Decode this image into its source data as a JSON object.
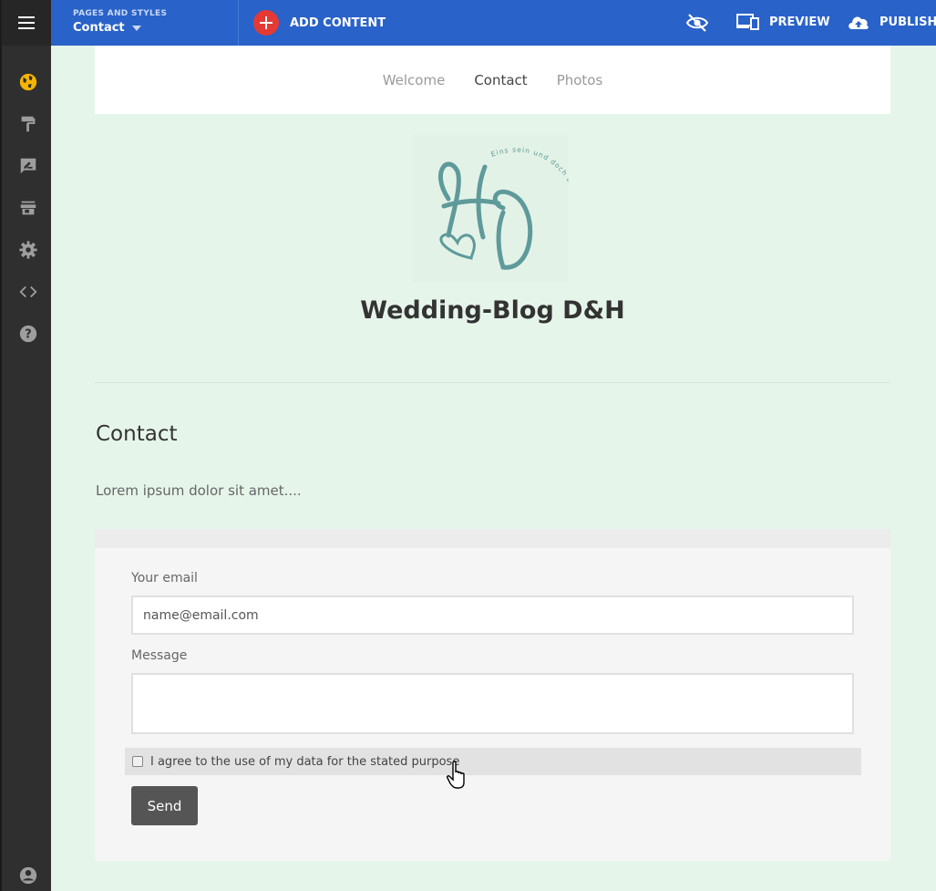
{
  "topbar": {
    "pages_caption": "PAGES AND STYLES",
    "current_page": "Contact",
    "add_content": "ADD CONTENT",
    "preview": "PREVIEW",
    "publish": "PUBLISH"
  },
  "sidebar": {
    "icons": [
      "menu-icon",
      "globe-icon",
      "paint-roller-icon",
      "edit-icon",
      "store-icon",
      "gear-icon",
      "code-icon",
      "help-icon",
      "account-icon"
    ]
  },
  "site_nav": {
    "items": [
      {
        "label": "Welcome",
        "active": false
      },
      {
        "label": "Contact",
        "active": true
      },
      {
        "label": "Photos",
        "active": false
      }
    ]
  },
  "site": {
    "title": "Wedding-Blog D&H",
    "logo_text": "Eins sein und doch zwei bleiben"
  },
  "page": {
    "heading": "Contact",
    "intro": "Lorem ipsum dolor sit amet...."
  },
  "form": {
    "email_label": "Your email",
    "email_placeholder": "name@email.com",
    "message_label": "Message",
    "consent_label": "I agree to the use of my data for the stated purpose",
    "send_label": "Send"
  },
  "colors": {
    "topbar": "#2962c8",
    "sidebar": "#2f2f2f",
    "page_bg": "#e6f5ea",
    "add_button": "#e53935",
    "globe_active": "#f5b400",
    "logo": "#5f9a9a"
  }
}
